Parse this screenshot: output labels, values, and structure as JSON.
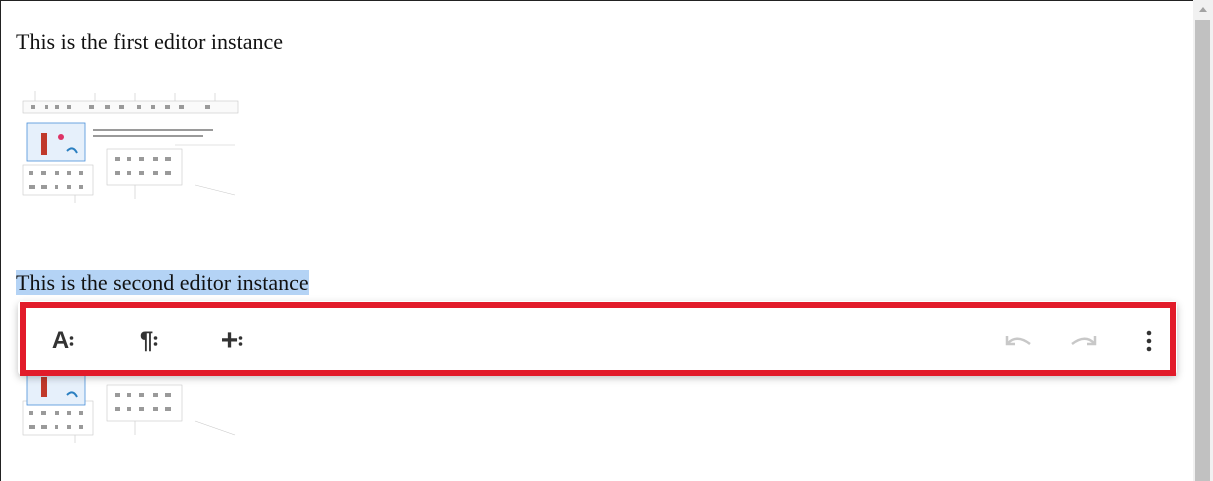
{
  "editor1": {
    "text": "This is the first editor instance"
  },
  "editor2": {
    "text": "This is the second editor instance"
  },
  "toolbar": {
    "text_format": "A",
    "paragraph_format": "¶",
    "insert": "+",
    "more_icon": "vertical-dots-icon",
    "undo_icon": "undo-icon",
    "redo_icon": "redo-icon"
  },
  "colors": {
    "highlight": "#e21b2a",
    "selection": "#b4d3f5",
    "icon": "#333333",
    "disabled_icon": "#c8c8c8"
  }
}
